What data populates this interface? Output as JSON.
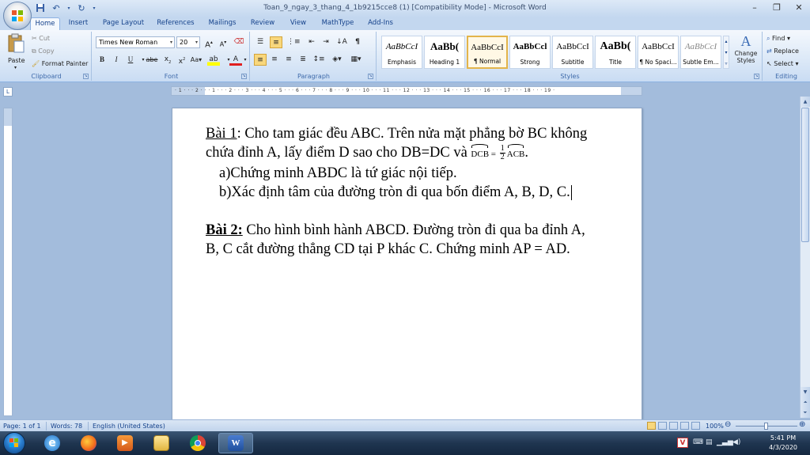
{
  "window": {
    "title": "Toan_9_ngay_3_thang_4_1b9215cce8 (1) [Compatibility Mode] - Microsoft Word"
  },
  "tabs": [
    "Home",
    "Insert",
    "Page Layout",
    "References",
    "Mailings",
    "Review",
    "View",
    "MathType",
    "Add-Ins"
  ],
  "ribbon": {
    "clipboard": {
      "label": "Clipboard",
      "paste": "Paste",
      "cut": "Cut",
      "copy": "Copy",
      "format_painter": "Format Painter"
    },
    "font": {
      "label": "Font",
      "name": "Times New Roman",
      "size": "20"
    },
    "paragraph": {
      "label": "Paragraph"
    },
    "styles": {
      "label": "Styles",
      "items": [
        {
          "preview": "AaBbCcI",
          "name": "Emphasis"
        },
        {
          "preview": "AaBb(",
          "name": "Heading 1"
        },
        {
          "preview": "AaBbCcI",
          "name": "¶ Normal"
        },
        {
          "preview": "AaBbCcl",
          "name": "Strong"
        },
        {
          "preview": "AaBbCcI",
          "name": "Subtitle"
        },
        {
          "preview": "AaBb(",
          "name": "Title"
        },
        {
          "preview": "AaBbCcI",
          "name": "¶ No Spaci..."
        },
        {
          "preview": "AaBbCcI",
          "name": "Subtle Em..."
        }
      ],
      "change_styles": "Change Styles"
    },
    "editing": {
      "label": "Editing",
      "find": "Find",
      "replace": "Replace",
      "select": "Select"
    }
  },
  "ruler": {
    "numbers": "· 1 · · · 2 · · · 1 · · · 2 · · · 3 · · · 4 · · · 5 · · · 6 · · · 7 · · · 8 · · · 9 · · · 10 · · · 11 · · · 12 · · · 13 · · · 14 · · · 15 · · · 16 · · · 17 · · · 18 · · · 19 ·"
  },
  "document": {
    "p1_label": "Bài 1",
    "p1_line1_rest": ": Cho tam giác đều ABC. Trên nửa mặt phẳng bờ BC không",
    "p1_line2_text": "chứa đỉnh A, lấy điểm D sao cho DB=DC và ",
    "p1_arc1": "DCB",
    "p1_eq": " = ",
    "p1_frac_num": "1",
    "p1_frac_den": "2",
    "p1_arc2": "ACB",
    "p1_end": ".",
    "item_a_marker": "a)",
    "item_a_text": "Chứng minh ABDC là tứ giác nội tiếp.",
    "item_b_marker": "b)",
    "item_b_text": "Xác định tâm của đường tròn đi qua bốn điểm A, B, D, C.",
    "p2_label": "Bài 2:",
    "p2_line1_rest": " Cho hình bình hành ABCD. Đường tròn đi qua ba đỉnh A,",
    "p2_line2": "B, C cắt đường thẳng CD tại P khác C. Chứng minh AP = AD."
  },
  "status": {
    "page": "Page: 1 of 1",
    "words": "Words: 78",
    "language": "English (United States)",
    "zoom": "100%"
  },
  "clock": {
    "time": "5:41 PM",
    "date": "4/3/2020"
  },
  "colors": {
    "ribbon_bg": "#dbe8f7",
    "title_bg": "#c3d7ef",
    "app_bg": "#a3bcdc",
    "taskbar": "#1f3550",
    "accent": "#15428b"
  }
}
